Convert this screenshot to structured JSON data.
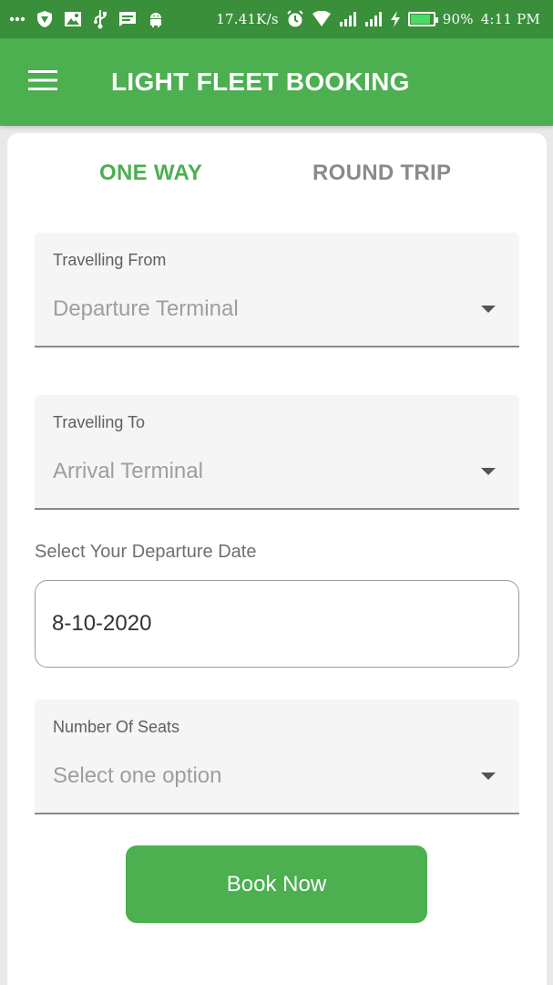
{
  "status_bar": {
    "network_speed": "17.41K/s",
    "battery_percent": "90%",
    "time": "4:11 PM",
    "icons": [
      "more-dots-icon",
      "vpn-shield-icon",
      "image-icon",
      "usb-icon",
      "message-icon",
      "android-icon",
      "alarm-icon",
      "wifi-icon",
      "signal-icon",
      "signal-icon",
      "charging-icon",
      "battery-icon"
    ]
  },
  "app_bar": {
    "title": "LIGHT FLEET BOOKING",
    "color": "#4caf50"
  },
  "tabs": [
    {
      "label": "ONE WAY",
      "active": true
    },
    {
      "label": "ROUND TRIP",
      "active": false
    }
  ],
  "form": {
    "from": {
      "label": "Travelling From",
      "value": "Departure Terminal"
    },
    "to": {
      "label": "Travelling To",
      "value": "Arrival Terminal"
    },
    "date": {
      "label": "Select Your Departure Date",
      "value": "8-10-2020"
    },
    "seats": {
      "label": "Number Of Seats",
      "value": "Select one option"
    },
    "submit_label": "Book Now"
  },
  "colors": {
    "accent": "#4caf50",
    "status_bar": "#3a8f3a",
    "inactive_tab": "#8a8a8a"
  }
}
